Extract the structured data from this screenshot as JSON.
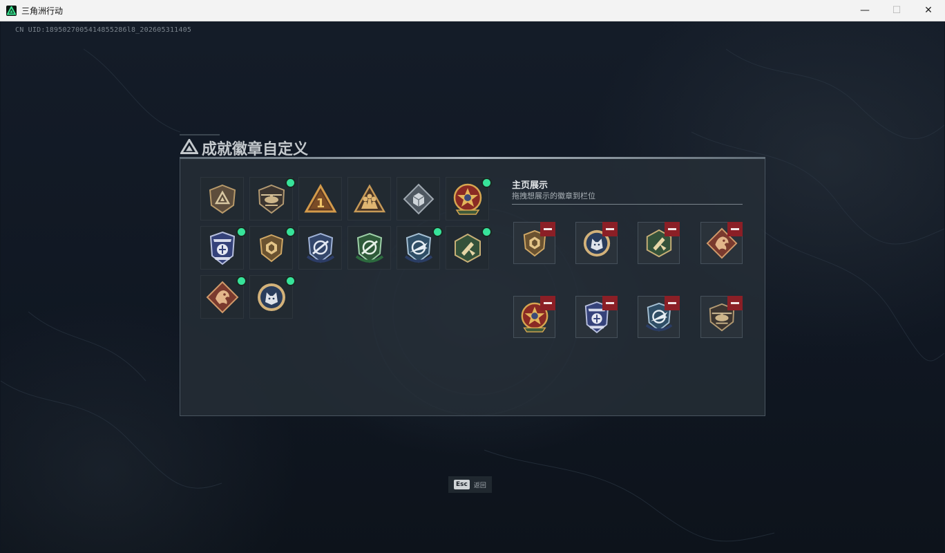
{
  "window": {
    "title": "三角洲行动",
    "minimize_label": "—",
    "maximize_label": "☐",
    "close_label": "✕"
  },
  "uid_text": "CN UID:1895027005414855286l8_202605311405",
  "dialog": {
    "title": "成就徽章自定义",
    "showcase_title": "主页展示",
    "showcase_subtitle": "拖拽想展示的徽章到栏位"
  },
  "badges": [
    {
      "icon": "triangle-shield-badge-icon",
      "new": false
    },
    {
      "icon": "helicopter-badge-icon",
      "new": true
    },
    {
      "icon": "number-one-triangle-badge-icon",
      "new": false
    },
    {
      "icon": "soldiers-triangle-badge-icon",
      "new": false
    },
    {
      "icon": "crate-diamond-badge-icon",
      "new": false
    },
    {
      "icon": "star-emblem-badge-icon",
      "new": true
    },
    {
      "icon": "eagle-shield-badge-icon",
      "new": true
    },
    {
      "icon": "gold-shield-badge-icon",
      "new": true
    },
    {
      "icon": "blue-crosshair-badge-icon",
      "new": false
    },
    {
      "icon": "green-crosshair-badge-icon",
      "new": false
    },
    {
      "icon": "blue-fighter-badge-icon",
      "new": true
    },
    {
      "icon": "green-hexagon-badge-icon",
      "new": true
    },
    {
      "icon": "dragon-diamond-badge-icon",
      "new": true
    },
    {
      "icon": "wolf-round-badge-icon",
      "new": true
    }
  ],
  "showcase_slots": [
    {
      "icon": "gold-shield-badge-icon"
    },
    {
      "icon": "wolf-round-badge-icon"
    },
    {
      "icon": "green-hexagon-badge-icon"
    },
    {
      "icon": "dragon-diamond-badge-icon"
    },
    {
      "icon": "star-emblem-badge-icon"
    },
    {
      "icon": "eagle-shield-badge-icon"
    },
    {
      "icon": "blue-fighter-badge-icon"
    },
    {
      "icon": "helicopter-badge-icon"
    }
  ],
  "esc_hint": {
    "key": "Esc",
    "label": "返回"
  },
  "colors": {
    "new_dot": "#37e39a",
    "remove_button": "#8b1f26",
    "panel": "#262e37"
  }
}
